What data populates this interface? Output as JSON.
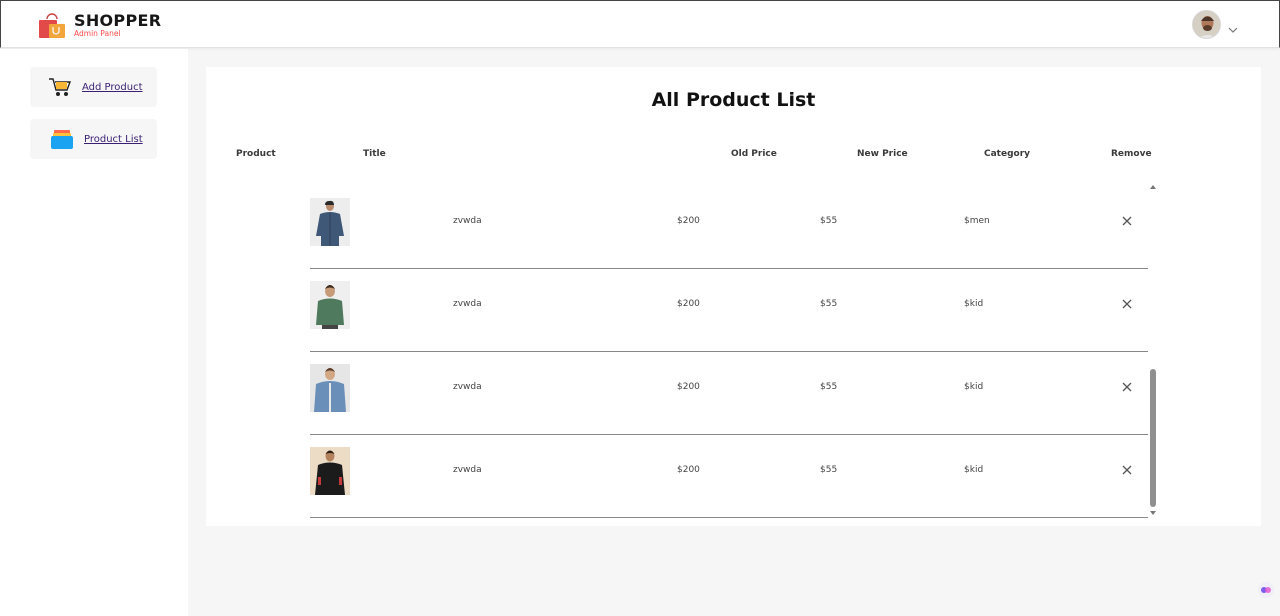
{
  "header": {
    "brand_name": "SHOPPER",
    "brand_sub": "Admin Panel"
  },
  "sidebar": {
    "items": [
      {
        "label": "Add Product",
        "icon": "cart-icon"
      },
      {
        "label": "Product List",
        "icon": "list-icon"
      }
    ]
  },
  "main": {
    "title": "All Product List",
    "columns": [
      "Product",
      "Title",
      "Old Price",
      "New Price",
      "Category",
      "Remove"
    ],
    "rows": [
      {
        "title": "zvwda",
        "old_price": "$200",
        "new_price": "$55",
        "category": "$men",
        "image": "man-denim-jacket"
      },
      {
        "title": "zvwda",
        "old_price": "$200",
        "new_price": "$55",
        "category": "$kid",
        "image": "boy-green-sweater"
      },
      {
        "title": "zvwda",
        "old_price": "$200",
        "new_price": "$55",
        "category": "$kid",
        "image": "boy-denim-jacket"
      },
      {
        "title": "zvwda",
        "old_price": "$200",
        "new_price": "$55",
        "category": "$kid",
        "image": "boy-black-jacket"
      }
    ]
  },
  "colors": {
    "accent_red": "#ff4d4d",
    "link_purple": "#3a1f73",
    "background": "#f6f6f6"
  }
}
